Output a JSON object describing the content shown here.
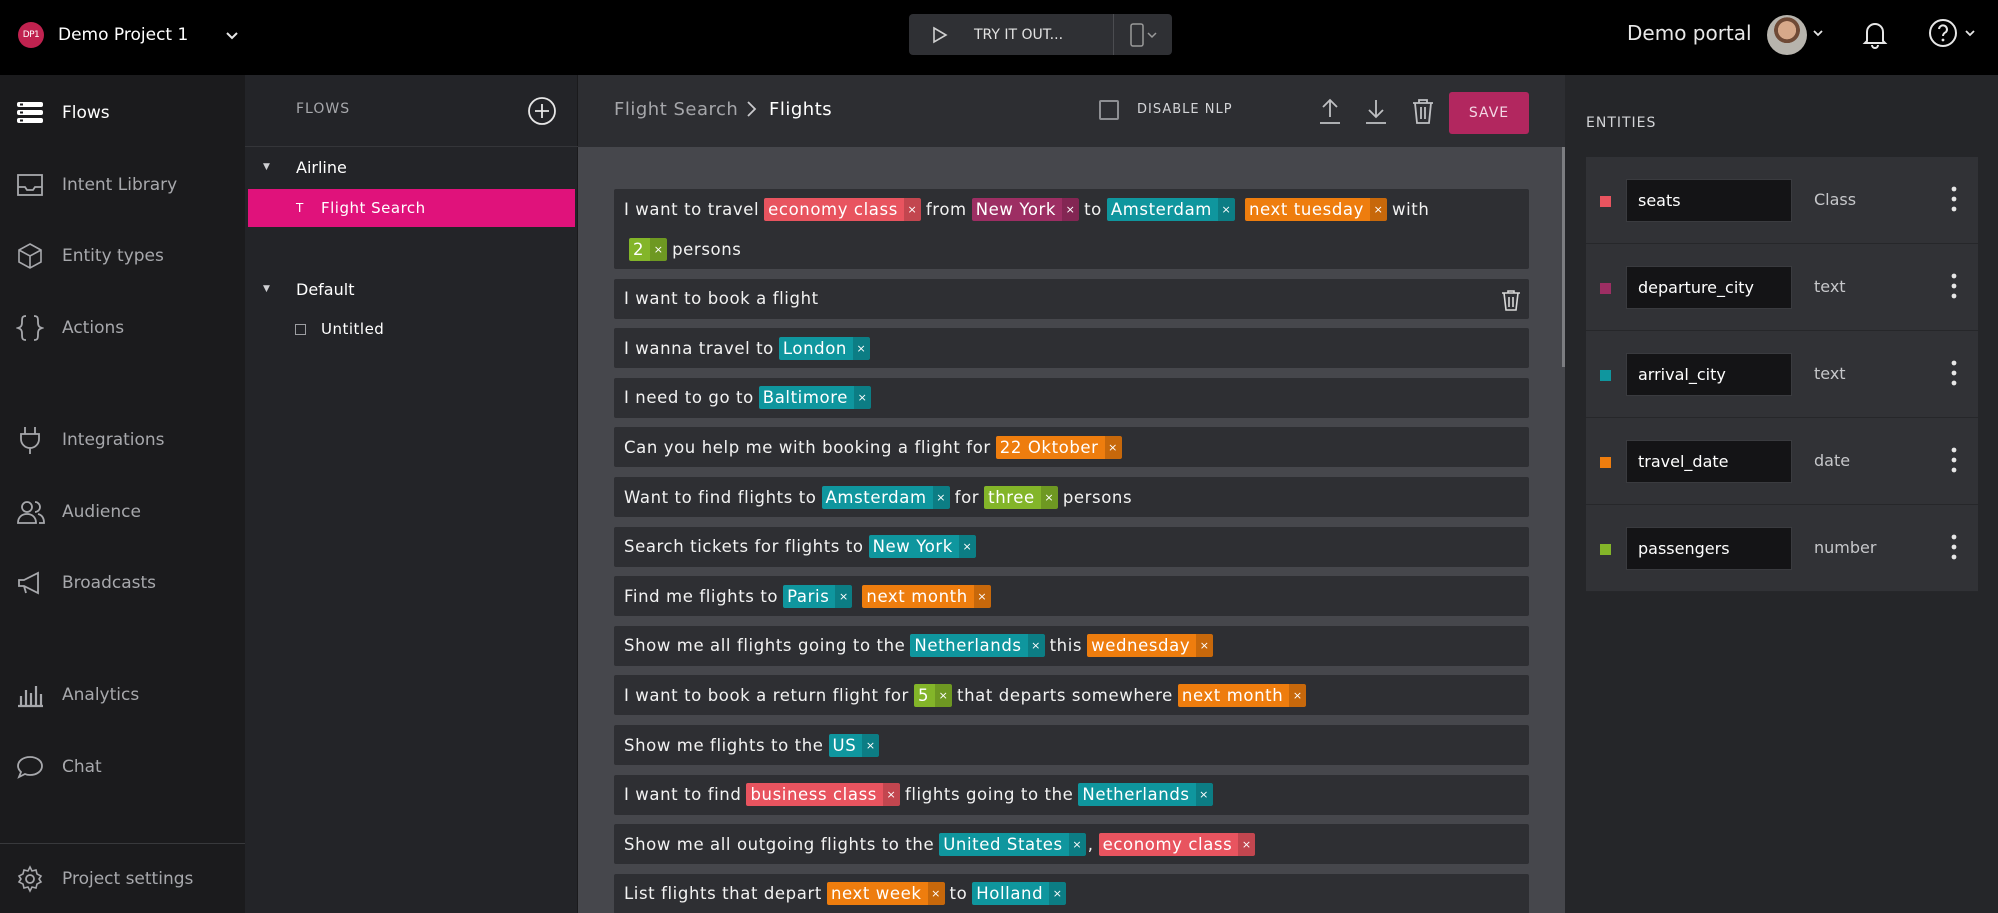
{
  "header": {
    "project_avatar": "DP1",
    "project_name": "Demo Project 1",
    "try_it_label": "TRY IT OUT...",
    "portal_name": "Demo portal"
  },
  "leftnav": {
    "items": [
      {
        "label": "Flows",
        "icon": "flows-icon",
        "active": true
      },
      {
        "label": "Intent Library",
        "icon": "inbox-icon"
      },
      {
        "label": "Entity types",
        "icon": "cube-icon"
      },
      {
        "label": "Actions",
        "icon": "braces-icon"
      },
      {
        "label": "Integrations",
        "icon": "plug-icon"
      },
      {
        "label": "Audience",
        "icon": "users-icon"
      },
      {
        "label": "Broadcasts",
        "icon": "megaphone-icon"
      },
      {
        "label": "Analytics",
        "icon": "bar-chart-icon"
      },
      {
        "label": "Chat",
        "icon": "chat-bubble-icon"
      },
      {
        "label": "Project settings",
        "icon": "gear-icon"
      }
    ]
  },
  "flows": {
    "title": "FLOWS",
    "groups": [
      {
        "name": "Airline",
        "items": [
          {
            "label": "Flight Search",
            "active": true
          }
        ]
      },
      {
        "name": "Default",
        "items": [
          {
            "label": "Untitled",
            "active": false
          }
        ]
      }
    ]
  },
  "main": {
    "breadcrumb_parent": "Flight Search",
    "breadcrumb_current": "Flights",
    "disable_nlp_label": "DISABLE NLP",
    "save_label": "SAVE"
  },
  "colors": {
    "seats": "#e8545f",
    "departure_city": "#9d2e63",
    "arrival_city": "#0f969e",
    "travel_date": "#ee7d0e",
    "passengers": "#83b529"
  },
  "utterances": [
    {
      "lines": [
        [
          {
            "t": "I want to travel"
          },
          {
            "e": "economy class",
            "c": "seats"
          },
          {
            "t": "from"
          },
          {
            "e": "New York",
            "c": "departure_city"
          },
          {
            "t": "to"
          },
          {
            "e": "Amsterdam",
            "c": "arrival_city"
          },
          {
            "e": "next tuesday",
            "c": "travel_date"
          },
          {
            "t": "with"
          }
        ],
        [
          {
            "e": "2",
            "c": "passengers"
          },
          {
            "t": "persons"
          }
        ]
      ]
    },
    {
      "lines": [
        [
          {
            "t": "I want to book a flight"
          }
        ]
      ],
      "trash": true
    },
    {
      "lines": [
        [
          {
            "t": "I wanna travel to"
          },
          {
            "e": "London",
            "c": "arrival_city"
          }
        ]
      ]
    },
    {
      "lines": [
        [
          {
            "t": "I need to go to"
          },
          {
            "e": "Baltimore",
            "c": "arrival_city"
          }
        ]
      ]
    },
    {
      "lines": [
        [
          {
            "t": "Can you help me with booking a flight for"
          },
          {
            "e": "22 Oktober",
            "c": "travel_date"
          }
        ]
      ]
    },
    {
      "lines": [
        [
          {
            "t": "Want to find flights to"
          },
          {
            "e": "Amsterdam",
            "c": "arrival_city"
          },
          {
            "t": "for"
          },
          {
            "e": "three",
            "c": "passengers"
          },
          {
            "t": "persons"
          }
        ]
      ]
    },
    {
      "lines": [
        [
          {
            "t": "Search tickets for flights to"
          },
          {
            "e": "New York",
            "c": "arrival_city"
          }
        ]
      ]
    },
    {
      "lines": [
        [
          {
            "t": "Find me flights to"
          },
          {
            "e": "Paris",
            "c": "arrival_city"
          },
          {
            "e": "next month",
            "c": "travel_date"
          }
        ]
      ]
    },
    {
      "lines": [
        [
          {
            "t": "Show me all flights going to the"
          },
          {
            "e": "Netherlands",
            "c": "arrival_city"
          },
          {
            "t": "this"
          },
          {
            "e": "wednesday",
            "c": "travel_date"
          }
        ]
      ]
    },
    {
      "lines": [
        [
          {
            "t": "I want to book a return flight for"
          },
          {
            "e": "5",
            "c": "passengers"
          },
          {
            "t": "that departs somewhere"
          },
          {
            "e": "next month",
            "c": "travel_date"
          }
        ]
      ]
    },
    {
      "lines": [
        [
          {
            "t": "Show me flights to the"
          },
          {
            "e": "US",
            "c": "arrival_city"
          }
        ]
      ]
    },
    {
      "lines": [
        [
          {
            "t": "I want to find"
          },
          {
            "e": "business class",
            "c": "seats"
          },
          {
            "t": "flights going to the"
          },
          {
            "e": "Netherlands",
            "c": "arrival_city"
          }
        ]
      ]
    },
    {
      "lines": [
        [
          {
            "t": "Show me all outgoing flights to the"
          },
          {
            "e": "United States",
            "c": "arrival_city"
          },
          {
            "t": ","
          },
          {
            "e": "economy class",
            "c": "seats"
          }
        ]
      ]
    },
    {
      "lines": [
        [
          {
            "t": "List flights that depart"
          },
          {
            "e": "next week",
            "c": "travel_date"
          },
          {
            "t": "to"
          },
          {
            "e": "Holland",
            "c": "arrival_city"
          }
        ]
      ]
    }
  ],
  "entities": {
    "title": "ENTITIES",
    "items": [
      {
        "name": "seats",
        "type": "Class",
        "color_key": "seats"
      },
      {
        "name": "departure_city",
        "type": "text",
        "color_key": "departure_city"
      },
      {
        "name": "arrival_city",
        "type": "text",
        "color_key": "arrival_city"
      },
      {
        "name": "travel_date",
        "type": "date",
        "color_key": "travel_date"
      },
      {
        "name": "passengers",
        "type": "number",
        "color_key": "passengers"
      }
    ]
  }
}
